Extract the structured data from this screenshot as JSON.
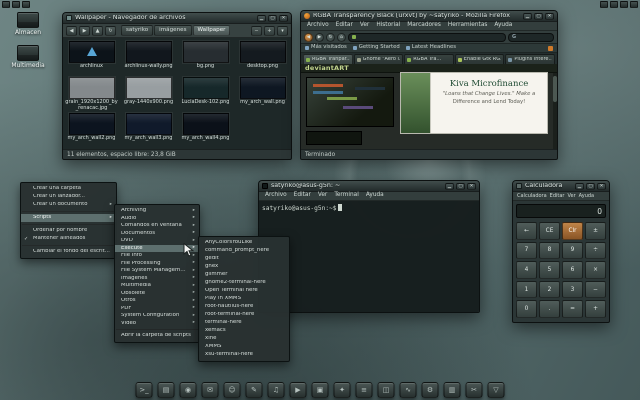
{
  "window_controls": [
    {
      "name": "minimize-button",
      "glyph": "▁"
    },
    {
      "name": "maximize-button",
      "glyph": "▢"
    },
    {
      "name": "close-button",
      "glyph": "✕"
    }
  ],
  "panel": {
    "left_icons": [
      "workspace-switcher-icon",
      "window-list-icon",
      "show-desktop-icon"
    ],
    "right_icons": [
      "notification-icon",
      "network-icon",
      "volume-icon",
      "clock-icon"
    ]
  },
  "desktop": {
    "icons": [
      {
        "label": "Almacen",
        "icon": "drive-icon"
      },
      {
        "label": "Multimedia",
        "icon": "multimedia-folder-icon"
      }
    ]
  },
  "file_manager": {
    "title": "Wallpaper - Navegador de archivos",
    "nav_buttons": [
      {
        "name": "back-icon",
        "glyph": "◀"
      },
      {
        "name": "forward-icon",
        "glyph": "▶"
      },
      {
        "name": "up-icon",
        "glyph": "▲"
      },
      {
        "name": "reload-icon",
        "glyph": "↻"
      }
    ],
    "breadcrumbs": [
      {
        "label": "satyriko"
      },
      {
        "label": "imágenes"
      },
      {
        "label": "Wallpaper",
        "active": true
      }
    ],
    "view_buttons": [
      {
        "name": "zoom-out-icon",
        "glyph": "−"
      },
      {
        "name": "zoom-in-icon",
        "glyph": "+"
      },
      {
        "name": "view-as-icon",
        "glyph": "▾"
      }
    ],
    "items": [
      {
        "name": "archlinux",
        "color": "#0c1319",
        "logo": "arch"
      },
      {
        "name": "archlinux-wally.png",
        "color": "#11171d"
      },
      {
        "name": "bg.png",
        "color": "#272d31"
      },
      {
        "name": "desktop.png",
        "color": "#141a1f"
      },
      {
        "name": "grain_1920x1200_by_renacac.jpg",
        "color": "#84898c"
      },
      {
        "name": "gray-1440x900.png",
        "color": "#989ea1"
      },
      {
        "name": "LuciaDesk-102.png",
        "color": "#16282a"
      },
      {
        "name": "my_arch_wall.png",
        "color": "#0e1722"
      },
      {
        "name": "my_arch_wall2.png",
        "color": "#0c141f"
      },
      {
        "name": "my_arch_wall3.png",
        "color": "#101a2b"
      },
      {
        "name": "my_arch_wall4.png",
        "color": "#0b1119"
      }
    ],
    "status": "11 elementos, espacio libre: 23,8 GiB"
  },
  "firefox": {
    "title": "RGBA Transparency Black [urxvt] by ~satyriko - Mozilla Firefox",
    "menu": [
      "Archivo",
      "Editar",
      "Ver",
      "Historial",
      "Marcadores",
      "Herramientas",
      "Ayuda"
    ],
    "nav_buttons": [
      {
        "name": "back-icon",
        "glyph": "◀",
        "accent": true
      },
      {
        "name": "forward-icon",
        "glyph": "▶"
      },
      {
        "name": "reload-icon",
        "glyph": "↻"
      },
      {
        "name": "home-icon",
        "glyph": "⌂"
      }
    ],
    "url_value": "",
    "search_engine": "G",
    "bookmarks": [
      "Más visitados",
      "Getting Started",
      "Latest Headlines"
    ],
    "tabs": [
      {
        "label": "RGBA Tranpar...",
        "color": "#86b14e",
        "active": true
      },
      {
        "label": "Gnome \"Aero l...",
        "color": "#9aa08a"
      },
      {
        "label": "RGBA Tra...",
        "color": "#86b14e"
      },
      {
        "label": "Enable Gtk RG...",
        "color": "#a9c45a"
      },
      {
        "label": "Plugins intere...",
        "color": "#7a95a5"
      }
    ],
    "page": {
      "brand": "deviantART",
      "ad_title": "Kiva Microfinance",
      "ad_line1": "\"Loans that Change Lives.\" Make a",
      "ad_line2": "Difference and Lend Today!"
    },
    "status": "Terminado"
  },
  "terminal": {
    "title": "satyriko@asus-g5n: ~",
    "menu": [
      "Archivo",
      "Editar",
      "Ver",
      "Terminal",
      "Ayuda"
    ],
    "prompt": "satyriko@asus-g5n:~$"
  },
  "calculator": {
    "title": "Calculadora",
    "menu": [
      "Calculadora",
      "Editar",
      "Ver",
      "Ayuda"
    ],
    "display": "0",
    "accent_button": "Clr",
    "buttons": [
      [
        "←",
        "CE",
        "Clr",
        "±"
      ],
      [
        "7",
        "8",
        "9",
        "÷"
      ],
      [
        "4",
        "5",
        "6",
        "×"
      ],
      [
        "1",
        "2",
        "3",
        "−"
      ],
      [
        "0",
        ".",
        "=",
        "+"
      ]
    ]
  },
  "context_menu": {
    "items": [
      {
        "label": "Crear una carpeta"
      },
      {
        "label": "Crear un lanzador..."
      },
      {
        "label": "Crear un documento",
        "submenu": true
      },
      {
        "sep": true
      },
      {
        "label": "Scripts",
        "submenu": true,
        "active": true
      },
      {
        "sep": true
      },
      {
        "label": "Ordenar por nombre"
      },
      {
        "label": "Mantener alineados",
        "checked": true
      },
      {
        "sep": true
      },
      {
        "label": "Cambiar el fondo del escritorio"
      }
    ]
  },
  "scripts_menu": {
    "items": [
      {
        "label": "Archiving",
        "submenu": true
      },
      {
        "label": "Audio",
        "submenu": true
      },
      {
        "label": "Comandos en ventana",
        "submenu": true
      },
      {
        "label": "Documentos",
        "submenu": true
      },
      {
        "label": "DVD",
        "submenu": true
      },
      {
        "label": "Execute",
        "submenu": true,
        "active": true
      },
      {
        "label": "File Info",
        "submenu": true
      },
      {
        "label": "File Processing",
        "submenu": true
      },
      {
        "label": "File System Management",
        "submenu": true
      },
      {
        "label": "Imagenes",
        "submenu": true
      },
      {
        "label": "Multimedia",
        "submenu": true
      },
      {
        "label": "Obsolete",
        "submenu": true
      },
      {
        "label": "Otros",
        "submenu": true
      },
      {
        "label": "PDF",
        "submenu": true
      },
      {
        "label": "System Configuration",
        "submenu": true
      },
      {
        "label": "Video",
        "submenu": true
      },
      {
        "sep": true
      },
      {
        "label": "Abrir la carpeta de scripts"
      }
    ]
  },
  "execute_menu": {
    "items": [
      {
        "label": "AnyColorsYouLike"
      },
      {
        "label": "command_prompt_here"
      },
      {
        "label": "gedit"
      },
      {
        "label": "ghex"
      },
      {
        "label": "glimmer"
      },
      {
        "label": "gnome2-terminal-here"
      },
      {
        "label": "Open Terminal here"
      },
      {
        "label": "Play in XMMS"
      },
      {
        "label": "root-nautilus-here"
      },
      {
        "label": "root-terminal-here"
      },
      {
        "label": "terminal-here"
      },
      {
        "label": "xemacs"
      },
      {
        "label": "xine"
      },
      {
        "label": "XMMS"
      },
      {
        "label": "xsu-terminal-here"
      }
    ]
  },
  "dock": {
    "items": [
      {
        "name": "terminal",
        "glyph": ">_"
      },
      {
        "name": "file-manager",
        "glyph": "▤"
      },
      {
        "name": "web-browser",
        "glyph": "◉"
      },
      {
        "name": "mail",
        "glyph": "✉"
      },
      {
        "name": "messenger",
        "glyph": "☺"
      },
      {
        "name": "text-editor",
        "glyph": "✎"
      },
      {
        "name": "music-player",
        "glyph": "♫"
      },
      {
        "name": "video-player",
        "glyph": "▶"
      },
      {
        "name": "image-viewer",
        "glyph": "▣"
      },
      {
        "name": "graphics-editor",
        "glyph": "✦"
      },
      {
        "name": "office",
        "glyph": "≡"
      },
      {
        "name": "packages",
        "glyph": "◫"
      },
      {
        "name": "system-monitor",
        "glyph": "∿"
      },
      {
        "name": "settings",
        "glyph": "⚙"
      },
      {
        "name": "archive-manager",
        "glyph": "▥"
      },
      {
        "name": "screenshot",
        "glyph": "✂"
      },
      {
        "name": "trash",
        "glyph": "▽"
      }
    ]
  }
}
